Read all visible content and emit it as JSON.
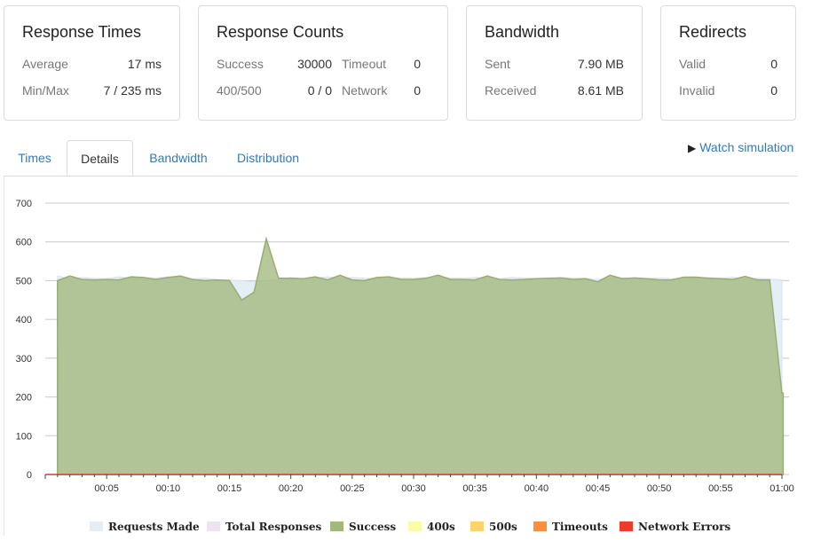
{
  "cards": {
    "response_times": {
      "title": "Response Times",
      "rows": [
        {
          "label": "Average",
          "value": "17 ms"
        },
        {
          "label": "Min/Max",
          "value": "7 / 235 ms"
        }
      ]
    },
    "response_counts": {
      "title": "Response Counts",
      "rows": [
        {
          "label": "Success",
          "value": "30000",
          "label2": "Timeout",
          "value2": "0"
        },
        {
          "label": "400/500",
          "value": "0 / 0",
          "label2": "Network",
          "value2": "0"
        }
      ]
    },
    "bandwidth": {
      "title": "Bandwidth",
      "rows": [
        {
          "label": "Sent",
          "value": "7.90 MB"
        },
        {
          "label": "Received",
          "value": "8.61 MB"
        }
      ]
    },
    "redirects": {
      "title": "Redirects",
      "rows": [
        {
          "label": "Valid",
          "value": "0"
        },
        {
          "label": "Invalid",
          "value": "0"
        }
      ]
    }
  },
  "tabs": [
    {
      "label": "Times",
      "active": false
    },
    {
      "label": "Details",
      "active": true
    },
    {
      "label": "Bandwidth",
      "active": false
    },
    {
      "label": "Distribution",
      "active": false
    }
  ],
  "watch_simulation": "Watch simulation",
  "legend": [
    {
      "label": "Requests Made",
      "color": "#e4eef6"
    },
    {
      "label": "Total Responses",
      "color": "#ede3f3"
    },
    {
      "label": "Success",
      "color": "#a3b87d"
    },
    {
      "label": "400s",
      "color": "#fdfaa8"
    },
    {
      "label": "500s",
      "color": "#fdd36a"
    },
    {
      "label": "Timeouts",
      "color": "#fb9041"
    },
    {
      "label": "Network Errors",
      "color": "#ee3b2b"
    }
  ],
  "chart_data": {
    "type": "area",
    "ylim": [
      0,
      700
    ],
    "yticks": [
      "0",
      "100",
      "200",
      "300",
      "400",
      "500",
      "600",
      "700"
    ],
    "xticks": [
      "00:05",
      "00:10",
      "00:15",
      "00:20",
      "00:25",
      "00:30",
      "00:35",
      "00:40",
      "00:45",
      "00:50",
      "00:55",
      "01:00"
    ],
    "grid": true,
    "series": [
      {
        "name": "Requests Made",
        "color": "#e4eef6",
        "x": [
          1,
          2,
          3,
          4,
          5,
          6,
          7,
          8,
          9,
          10,
          11,
          12,
          13,
          14,
          15,
          16,
          17,
          18,
          19,
          20,
          21,
          22,
          23,
          24,
          25,
          26,
          27,
          28,
          29,
          30,
          31,
          32,
          33,
          34,
          35,
          36,
          37,
          38,
          39,
          40,
          41,
          42,
          43,
          44,
          45,
          46,
          47,
          48,
          49,
          50,
          51,
          52,
          53,
          54,
          55,
          56,
          57,
          58,
          59,
          60
        ],
        "values": [
          512,
          505,
          508,
          506,
          505,
          510,
          506,
          508,
          507,
          510,
          508,
          505,
          506,
          503,
          502,
          500,
          497,
          500,
          504,
          508,
          505,
          507,
          510,
          506,
          508,
          506,
          505,
          508,
          507,
          506,
          508,
          510,
          507,
          506,
          508,
          507,
          505,
          508,
          507,
          506,
          505,
          508,
          507,
          506,
          503,
          506,
          507,
          505,
          506,
          507,
          505,
          506,
          507,
          508,
          506,
          509,
          505,
          506,
          504,
          502
        ]
      },
      {
        "name": "Success",
        "color": "#a3b87d",
        "x": [
          1,
          2,
          3,
          4,
          5,
          6,
          7,
          8,
          9,
          10,
          11,
          12,
          13,
          14,
          15,
          16,
          17,
          18,
          19,
          20,
          21,
          22,
          23,
          24,
          25,
          26,
          27,
          28,
          29,
          30,
          31,
          32,
          33,
          34,
          35,
          36,
          37,
          38,
          39,
          40,
          41,
          42,
          43,
          44,
          45,
          46,
          47,
          48,
          49,
          50,
          51,
          52,
          53,
          54,
          55,
          56,
          57,
          58,
          59,
          60,
          60.1
        ],
        "values": [
          500,
          512,
          503,
          502,
          503,
          502,
          510,
          508,
          503,
          508,
          512,
          503,
          500,
          502,
          500,
          450,
          470,
          608,
          506,
          506,
          505,
          510,
          502,
          514,
          502,
          500,
          508,
          510,
          503,
          503,
          506,
          514,
          503,
          503,
          502,
          512,
          503,
          502,
          503,
          505,
          506,
          507,
          503,
          505,
          497,
          514,
          505,
          507,
          505,
          502,
          502,
          509,
          509,
          506,
          505,
          503,
          511,
          502,
          502,
          210,
          210
        ]
      }
    ]
  }
}
